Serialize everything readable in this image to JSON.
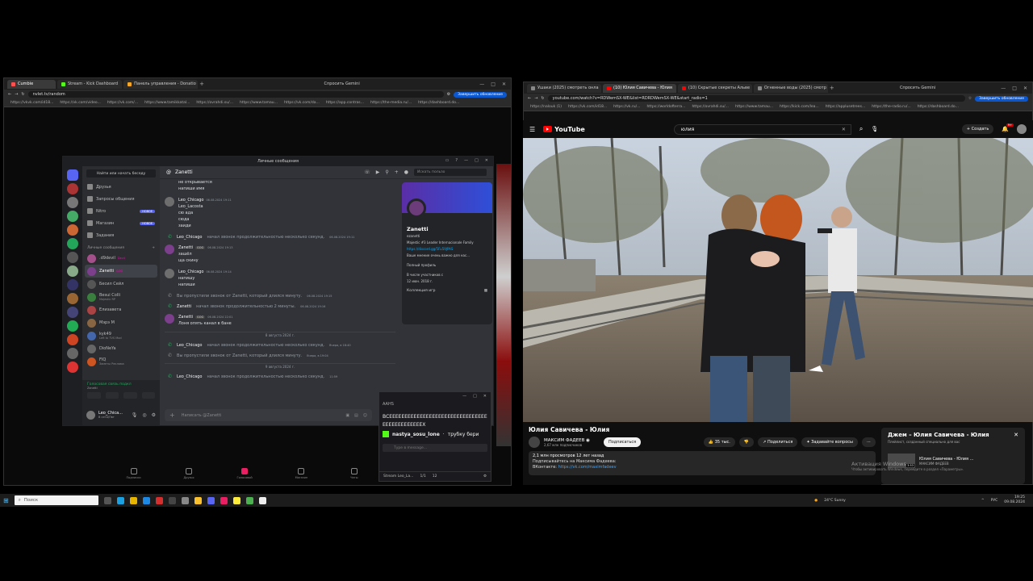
{
  "left_browser": {
    "tabs": [
      {
        "label": "Cumbie",
        "color": "#ff4f4f"
      },
      {
        "label": "Stream - Kick Dashboard",
        "color": "#53fc18"
      },
      {
        "label": "Панель управления - Donatio",
        "color": "#f6a623"
      }
    ],
    "gemini": "Спросить Gemini",
    "url": "nvlet.tv/random",
    "update_label": "Завершить обновление",
    "bookmarks": [
      "https://vkvk.com/id18...",
      "https://vk.com/video...",
      "https://vk.com/...",
      "https://www.tamikkatal...",
      "https://ovrahdi.su/...",
      "https://www.tamau...",
      "https://vk.com/da...",
      "https://app.contras...",
      "https://the-media.ru/...",
      "https://dashboard.do..."
    ]
  },
  "discord": {
    "window_title": "Личные сообщения",
    "find_button": "Найти или начать беседу",
    "nav": [
      {
        "label": "Друзья",
        "badge": ""
      },
      {
        "label": "Запросы общения",
        "badge": ""
      },
      {
        "label": "Nitro",
        "badge": "НОВОЕ"
      },
      {
        "label": "Магазин",
        "badge": "НОВОЕ"
      },
      {
        "label": "Задания",
        "badge": ""
      }
    ],
    "dm_header": "Личные сообщения",
    "dm_header_plus": "+",
    "dms": [
      {
        "name": ".d9devil",
        "sub": "",
        "tag": "Devil",
        "color": "#a4508b",
        "active": false
      },
      {
        "name": "Zanetti",
        "sub": "",
        "tag": "GOG",
        "color": "#7b3f8c",
        "active": true
      },
      {
        "name": "Бесил Сейл",
        "sub": "",
        "tag": "",
        "color": "#555",
        "active": false
      },
      {
        "name": "Besui Colli",
        "sub": "Majestic RP",
        "tag": "",
        "color": "#3b7f3f",
        "active": false
      },
      {
        "name": "Елизавета",
        "sub": "",
        "tag": "",
        "color": "#aa4444",
        "active": false
      },
      {
        "name": "Мэрэ М",
        "sub": "",
        "tag": "",
        "color": "#886644",
        "active": false
      },
      {
        "name": "kyk49",
        "sub": "Left to TVS Mod",
        "tag": "",
        "color": "#4466aa",
        "active": false
      },
      {
        "name": "DioNeYa",
        "sub": "",
        "tag": "",
        "color": "#666",
        "active": false
      },
      {
        "name": "FIQ",
        "sub": "Заметы Реклама",
        "tag": "",
        "color": "#cc5522",
        "active": false
      }
    ],
    "voice_status": "Голосовая связь подкл",
    "voice_sub": "Zanetti",
    "user_name": "Leo_Chica...",
    "user_status": "В сети/Пвт",
    "chat_title": "Zanetti",
    "search_placeholder": "Искать пользо",
    "top_text": "не открывается",
    "top_text2": "напиши имя",
    "messages": [
      {
        "type": "msg",
        "author": "Leo_Chicago",
        "time": "06.08.2024 19:11",
        "lines": [
          "Leo_Lacosta",
          "сю ада",
          "сюда",
          "заиди"
        ],
        "color": "#6e6e6e"
      },
      {
        "type": "sys",
        "miss": false,
        "author": "Leo_Chicago",
        "text": "начал звонок продолжительностью несколько секунд.",
        "time": "06.08.2024 19:11"
      },
      {
        "type": "msg",
        "author": "Zanetti",
        "badge": "GOG",
        "time": "06.08.2024 19:13",
        "lines": [
          "зашёл",
          "ща скину"
        ],
        "color": "#7b3f8c"
      },
      {
        "type": "msg",
        "author": "Leo_Chicago",
        "time": "06.08.2024 19:14",
        "lines": [
          "напишу",
          "напиши"
        ],
        "color": "#6e6e6e"
      },
      {
        "type": "sys",
        "miss": true,
        "author": "Zanetti",
        "text": "Вы пропустили звонок от Zanetti, который длился минуту.",
        "time": "06.08.2024 19:15"
      },
      {
        "type": "sys",
        "miss": false,
        "author": "Zanetti",
        "text": "начал звонок продолжительностью 2 минуты.",
        "time": "06.08.2024 19:16"
      },
      {
        "type": "msg",
        "author": "Zanetti",
        "badge": "GOG",
        "time": "06.08.2024 22:01",
        "lines": [
          "Лоня опять канал в бане"
        ],
        "color": "#7b3f8c"
      },
      {
        "type": "date",
        "text": "8 августа 2024 г."
      },
      {
        "type": "sys",
        "miss": false,
        "author": "Leo_Chicago",
        "text": "начал звонок продолжительностью несколько секунд.",
        "time": "Вчера, в 18:40"
      },
      {
        "type": "sys",
        "miss": true,
        "author": "Zanetti",
        "text": "Вы пропустили звонок от Zanetti, который длился минуту.",
        "time": "Вчера, в 19:04"
      },
      {
        "type": "date",
        "text": "9 августа 2024 г."
      },
      {
        "type": "sys",
        "miss": false,
        "author": "Leo_Chicago",
        "text": "начал звонок продолжительностью несколько секунд.",
        "time": "11:59"
      }
    ],
    "input_placeholder": "Написать @Zanetti",
    "profile": {
      "name": "Zanetti",
      "handle": "ezanetti",
      "org": "Majestic #3 Leader Internacionale Family",
      "link": "https://discord.gg/5Fu59JPAS",
      "note": "Ваше мнение очень важно для нас...",
      "full": "Полный профиль",
      "since_label": "В числе участников с",
      "since": "12 июн. 2018 г.",
      "collection": "Коллекция игр"
    },
    "app_nav": [
      "Подписки",
      "Друзья",
      "Голосовой",
      "Магазин",
      "Чаты"
    ]
  },
  "popup": {
    "title": "AAHS",
    "text": "ВСЕЕЕЕЕЕЕЕЕЕЕЕЕЕЕЕЕЕЕЕЕЕЕЕЕЕЕЕЕЕЕЕЕЕЕЕЕЕЕЕЕЕЕЕЕХ",
    "user": "nastya_sosu_lone",
    "msg": "трубку бери",
    "placeholder": "Туре в message...",
    "footer_user": "Stream Leo_La...",
    "footer_count": "1/1",
    "footer_num": "12"
  },
  "right_browser": {
    "tabs": [
      {
        "label": "Ушаки (2025) смотреть онла",
        "color": "#888"
      },
      {
        "label": "(10) Юлия Савичева - Юлия",
        "color": "#ff0000"
      },
      {
        "label": "(10) Скрытые секреты Альвe",
        "color": "#ff0000"
      },
      {
        "label": "Огненные воды (2025) смотр",
        "color": "#888"
      }
    ],
    "gemini": "Спросить Gemini",
    "url": "youtube.com/watch?v=RDWemSX-WE&list=RDRDWemSX-WE&start_radio=1",
    "update_label": "Завершить обновление",
    "bookmarks": [
      "https://nalouk (1)",
      "https://vk.com/id18...",
      "https://vk.ru/...",
      "https://worldofterra...",
      "https://ovrahdi.su/...",
      "https://www.tamau...",
      "https://kick.com/lea...",
      "https://applusetrees...",
      "https://the-radio.ru/...",
      "https://dashboard.do..."
    ]
  },
  "youtube": {
    "logo": "YouTube",
    "search": "юлия",
    "create": "Создать",
    "notif_count": "9+",
    "title": "Юлия Савичева - Юлия",
    "channel": "МАКСИМ ФАДЕЕВ",
    "subs": "2,67 млн подписчиков",
    "subscribe": "Подписаться",
    "likes": "35 тыс.",
    "share": "Поделиться",
    "ask": "Задавайте вопросы",
    "views": "2,1 млн просмотров  12 лет назад",
    "desc1": "Подписывайтесь на Максима Фадеева:",
    "desc2_label": "ВКонтакте:",
    "desc2_link": "https://vk.com/maximfadeev",
    "side_title": "Джем – Юлия Савичева - Юлия",
    "side_sub": "Плейлист, созданный специально для вас",
    "side_item": "Юлия Савичева - Юлия ...",
    "side_item_ch": "МАКСИМ ФАДЕЕВ",
    "side_item_time": "3:53",
    "activation": "Активация Windows",
    "activation_sub": "Чтобы активировать Windows, перейдите в раздел «Параметры»."
  },
  "taskbar": {
    "search": "Поиск",
    "weather": "24°C  Sunny",
    "lang": "РУС",
    "time": "19:25",
    "date": "09.08.2024"
  }
}
